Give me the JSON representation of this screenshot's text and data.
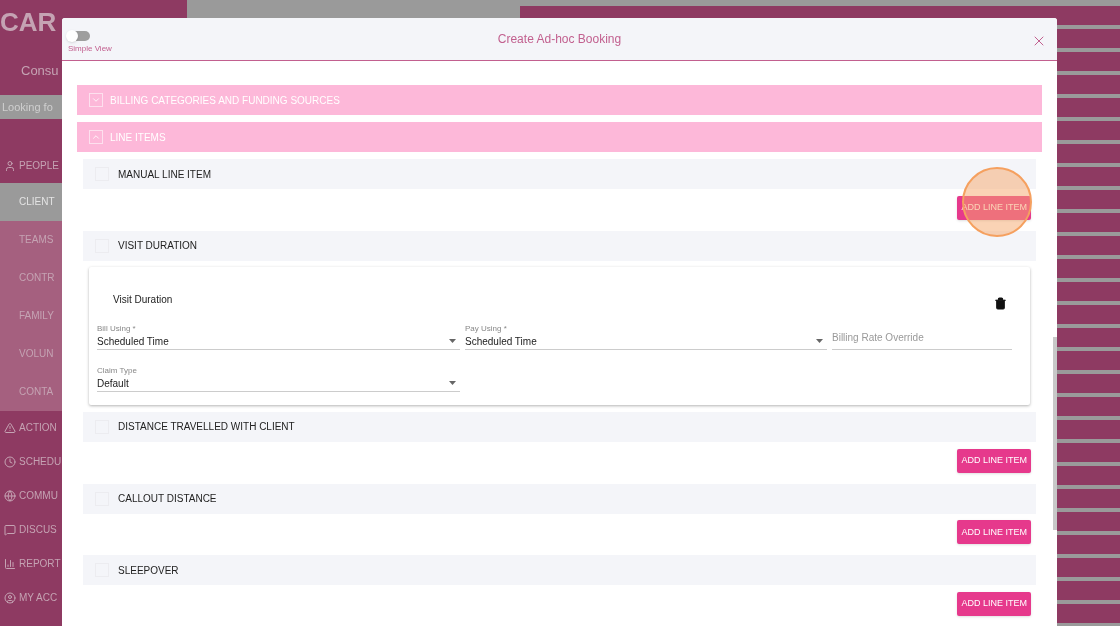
{
  "background": {
    "logo": "CAR",
    "subtitle": "Consu",
    "search": {
      "placeholder": "Looking fo"
    },
    "nav": [
      {
        "label": "PEOPLE",
        "kind": "main",
        "selected": false
      },
      {
        "label": "CLIENT",
        "kind": "sub",
        "selected": true
      },
      {
        "label": "TEAMS",
        "kind": "sub",
        "selected": false
      },
      {
        "label": "CONTR",
        "kind": "sub",
        "selected": false
      },
      {
        "label": "FAMILY",
        "kind": "sub",
        "selected": false
      },
      {
        "label": "VOLUN",
        "kind": "sub",
        "selected": false
      },
      {
        "label": "CONTA",
        "kind": "sub",
        "selected": false
      },
      {
        "label": "ACTION",
        "kind": "main",
        "selected": false
      },
      {
        "label": "SCHEDU",
        "kind": "main",
        "selected": false
      },
      {
        "label": "COMMU",
        "kind": "main",
        "selected": false
      },
      {
        "label": "DISCUS",
        "kind": "main",
        "selected": false
      },
      {
        "label": "REPORT",
        "kind": "main",
        "selected": false
      },
      {
        "label": "MY ACC",
        "kind": "main",
        "selected": false
      }
    ]
  },
  "dialog": {
    "title": "Create Ad-hoc Booking",
    "simple_view": {
      "label": "Simple View",
      "on": false
    },
    "sections": [
      {
        "label": "BILLING CATEGORIES AND FUNDING SOURCES",
        "expanded": false
      },
      {
        "label": "LINE ITEMS",
        "expanded": true
      }
    ],
    "line_items": [
      {
        "label": "MANUAL LINE ITEM",
        "kind": "button",
        "button": "ADD LINE ITEM",
        "highlighted": true
      },
      {
        "label": "VISIT DURATION",
        "kind": "card",
        "card": {
          "title": "Visit Duration",
          "fields": [
            {
              "label": "Bill Using *",
              "value": "Scheduled Time",
              "kind": "select"
            },
            {
              "label": "Pay Using *",
              "value": "Scheduled Time",
              "kind": "select"
            },
            {
              "placeholder": "Billing Rate Override",
              "kind": "text"
            },
            {
              "label": "Claim Type",
              "value": "Default",
              "kind": "select"
            }
          ]
        }
      },
      {
        "label": "DISTANCE TRAVELLED WITH CLIENT",
        "kind": "button",
        "button": "ADD LINE ITEM",
        "highlighted": false
      },
      {
        "label": "CALLOUT DISTANCE",
        "kind": "button",
        "button": "ADD LINE ITEM",
        "highlighted": false
      },
      {
        "label": "SLEEPOVER",
        "kind": "button",
        "button": "ADD LINE ITEM",
        "highlighted": false
      }
    ]
  }
}
